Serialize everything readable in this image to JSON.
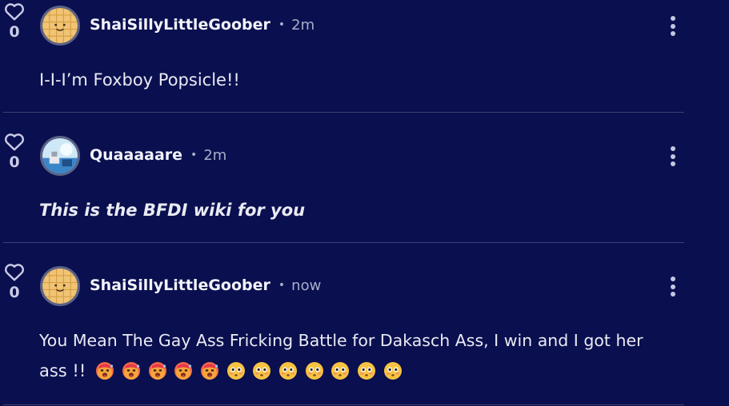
{
  "comments": [
    {
      "likes": "0",
      "username": "ShaiSillyLittleGoober",
      "time": "2m",
      "text": "I-I-I’m Foxboy Popsicle!!",
      "avatar": "waffle-avatar"
    },
    {
      "likes": "0",
      "username": "Quaaaaare",
      "time": "2m",
      "text": "This is the BFDI wiki for you",
      "avatar": "scene-avatar"
    },
    {
      "likes": "0",
      "username": "ShaiSillyLittleGoober",
      "time": "now",
      "text_line1": "You Mean The Gay Ass Fricking Battle for Dakasch Ass, I win and I got her",
      "text_line2": "ass !!",
      "avatar": "waffle-avatar",
      "emojis": [
        "hot-face-emoji",
        "hot-face-emoji",
        "hot-face-emoji",
        "hot-face-emoji",
        "hot-face-emoji",
        "flushed-face-emoji",
        "flushed-face-emoji",
        "flushed-face-emoji",
        "flushed-face-emoji",
        "flushed-face-emoji",
        "flushed-face-emoji",
        "flushed-face-emoji"
      ]
    }
  ],
  "icons": {
    "like": "heart-outline-icon",
    "more": "kebab-menu-icon"
  },
  "colors": {
    "background": "#0a0f4f",
    "divider": "#3b4173",
    "text": "#e9eaf3",
    "muted": "#a9adc9"
  }
}
